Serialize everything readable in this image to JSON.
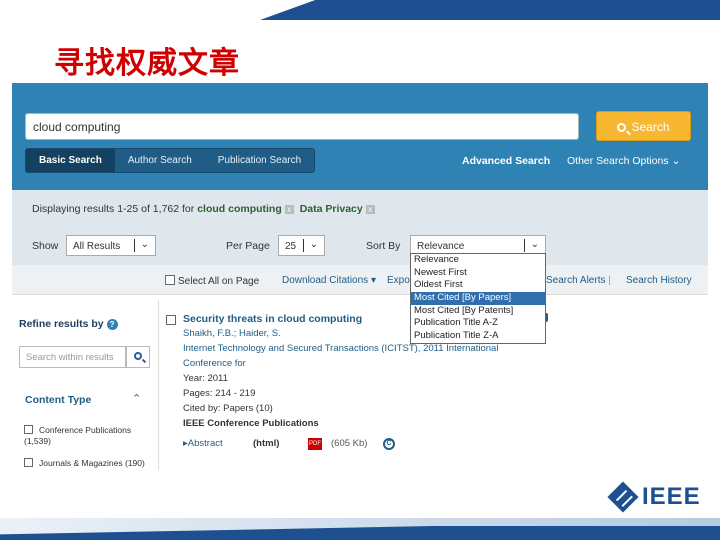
{
  "slide": {
    "title": "寻找权威文章",
    "logo_text": "IEEE",
    "accent_color": "#1d4f91",
    "title_color": "#d00000"
  },
  "search": {
    "query": "cloud computing",
    "button_label": "Search",
    "tabs": [
      {
        "label": "Basic Search",
        "active": true
      },
      {
        "label": "Author Search",
        "active": false
      },
      {
        "label": "Publication Search",
        "active": false
      }
    ],
    "advanced_link": "Advanced Search",
    "other_options": "Other Search Options",
    "panel_color": "#2f83b4",
    "button_color": "#f7b731"
  },
  "results": {
    "summary_prefix": "Displaying results 1-25 of 1,762 for",
    "query_terms": [
      "cloud computing",
      "Data Privacy"
    ],
    "show_label": "Show",
    "show_value": "All Results",
    "per_page_label": "Per Page",
    "per_page_value": "25",
    "sort_label": "Sort By",
    "sort_value": "Relevance",
    "sort_options": [
      {
        "label": "Relevance",
        "active": false
      },
      {
        "label": "Newest First",
        "active": false
      },
      {
        "label": "Oldest First",
        "active": false
      },
      {
        "label": "Most Cited [By Papers]",
        "active": true
      },
      {
        "label": "Most Cited [By Patents]",
        "active": false
      },
      {
        "label": "Publication Title A-Z",
        "active": false
      },
      {
        "label": "Publication Title Z-A",
        "active": false
      }
    ]
  },
  "actions": {
    "select_all": "Select All on Page",
    "download": "Download Citations",
    "export": "Expo",
    "search_alerts": "Search Alerts",
    "search_history": "Search History"
  },
  "refine": {
    "title": "Refine results by",
    "within_placeholder": "Search within results",
    "facet_title": "Content Type",
    "facets": [
      {
        "label": "Conference Publications (1,539)"
      },
      {
        "label": "Journals & Magazines (190)"
      }
    ]
  },
  "result_item": {
    "title": "Security threats in cloud computing",
    "authors": "Shaikh, F.B.; Haider, S.",
    "venue": "Internet Technology and Secured Transactions (ICITST), 2011 International",
    "venue2": "Conference for",
    "year": "Year: 2011",
    "pages": "Pages: 214 - 219",
    "cited": "Cited by: Papers (10)",
    "publisher": "IEEE Conference Publications",
    "abstract": "Abstract",
    "html": "(html)",
    "pdf_size": "(605 Kb)"
  }
}
